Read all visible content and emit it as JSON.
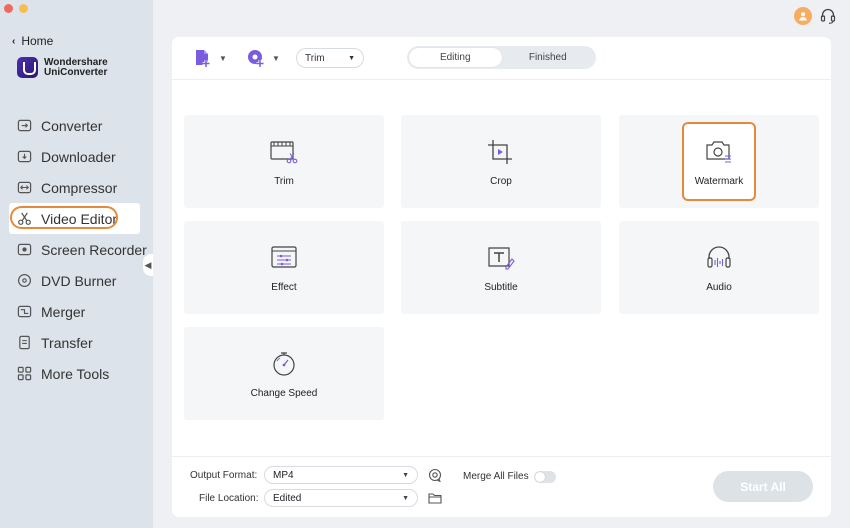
{
  "window": {
    "traffic_lights": [
      "close",
      "minimize"
    ]
  },
  "sidebar": {
    "home_label": "Home",
    "brand_line1": "Wondershare",
    "brand_line2": "UniConverter",
    "items": [
      {
        "label": "Converter",
        "icon": "converter-icon"
      },
      {
        "label": "Downloader",
        "icon": "downloader-icon"
      },
      {
        "label": "Compressor",
        "icon": "compressor-icon"
      },
      {
        "label": "Video Editor",
        "icon": "video-editor-icon",
        "active": true
      },
      {
        "label": "Screen Recorder",
        "icon": "screen-recorder-icon"
      },
      {
        "label": "DVD Burner",
        "icon": "dvd-burner-icon"
      },
      {
        "label": "Merger",
        "icon": "merger-icon"
      },
      {
        "label": "Transfer",
        "icon": "transfer-icon"
      },
      {
        "label": "More Tools",
        "icon": "more-tools-icon"
      }
    ]
  },
  "toolbar": {
    "edit_select_value": "Trim",
    "tabs": [
      {
        "label": "Editing",
        "active": true
      },
      {
        "label": "Finished",
        "active": false
      }
    ]
  },
  "tools": [
    {
      "label": "Trim",
      "icon": "trim-icon"
    },
    {
      "label": "Crop",
      "icon": "crop-icon"
    },
    {
      "label": "Watermark",
      "icon": "watermark-icon",
      "highlighted": true
    },
    {
      "label": "Effect",
      "icon": "effect-icon"
    },
    {
      "label": "Subtitle",
      "icon": "subtitle-icon"
    },
    {
      "label": "Audio",
      "icon": "audio-icon"
    },
    {
      "label": "Change Speed",
      "icon": "change-speed-icon"
    }
  ],
  "bottom": {
    "output_format_label": "Output Format:",
    "output_format_value": "MP4",
    "file_location_label": "File Location:",
    "file_location_value": "Edited",
    "merge_label": "Merge All Files",
    "merge_enabled": false,
    "start_all_label": "Start All"
  },
  "colors": {
    "accent_highlight": "#e58a3b",
    "brand_purple": "#7b5ce0",
    "sidebar_bg": "#dde3ea"
  }
}
